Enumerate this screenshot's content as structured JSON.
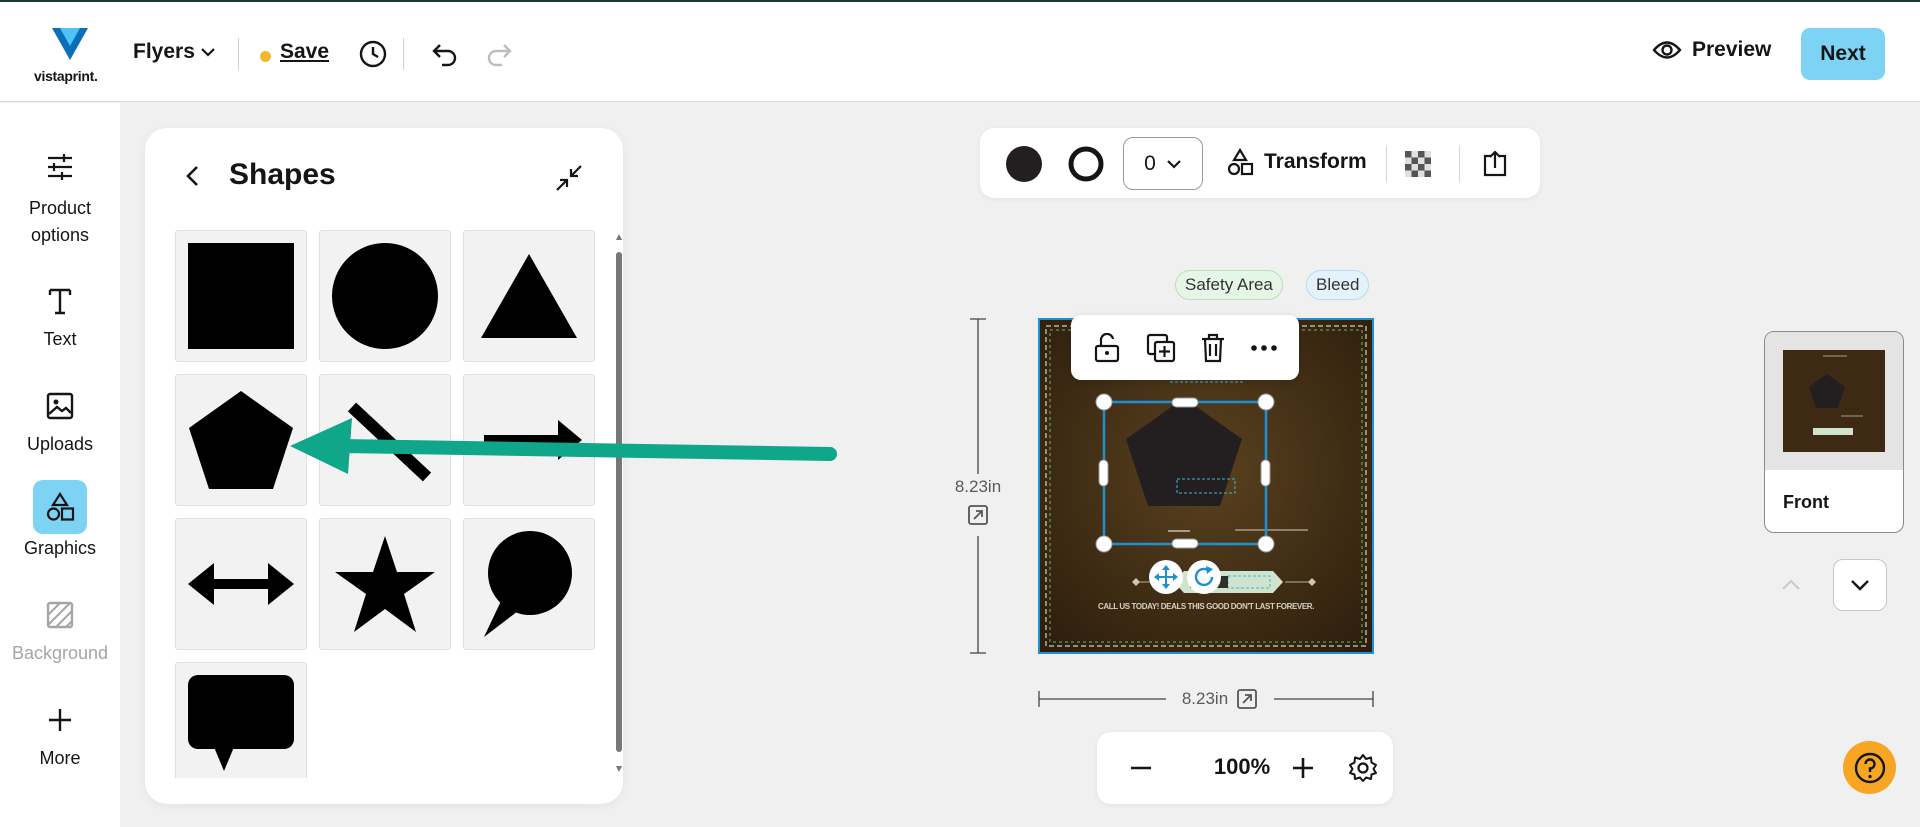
{
  "header": {
    "logo_text": "vistaprint.",
    "product": "Flyers",
    "save_label": "Save",
    "preview_label": "Preview",
    "next_label": "Next"
  },
  "sidebar": {
    "items": [
      {
        "label": "Product options",
        "icon": "sliders-icon"
      },
      {
        "label": "Text",
        "icon": "text-icon"
      },
      {
        "label": "Uploads",
        "icon": "image-icon"
      },
      {
        "label": "Graphics",
        "icon": "shapes-icon",
        "active": true
      },
      {
        "label": "Background",
        "icon": "background-icon",
        "disabled": true
      },
      {
        "label": "More",
        "icon": "plus-icon"
      }
    ]
  },
  "panel": {
    "title": "Shapes",
    "shapes": [
      "square",
      "circle",
      "triangle",
      "pentagon",
      "line",
      "arrow",
      "double-arrow",
      "star",
      "speech-bubble-round",
      "speech-bubble-rect"
    ]
  },
  "toolbar": {
    "fill_color": "#231f20",
    "stroke_width": "0",
    "transform_label": "Transform"
  },
  "canvas": {
    "safety_label": "Safety Area",
    "bleed_label": "Bleed",
    "height_label": "8.23in",
    "width_label": "8.23in",
    "background_color": "#3e2a14",
    "selection_color": "#1e90d2",
    "flyer_small_text": "CALL US TODAY! DEALS THIS GOOD DON'T LAST FOREVER."
  },
  "zoom": {
    "value": "100%"
  },
  "pages": {
    "items": [
      {
        "label": "Front"
      }
    ]
  },
  "colors": {
    "accent": "#7dd3f4",
    "annotation_arrow": "#10a68a",
    "help": "#f6a623"
  }
}
